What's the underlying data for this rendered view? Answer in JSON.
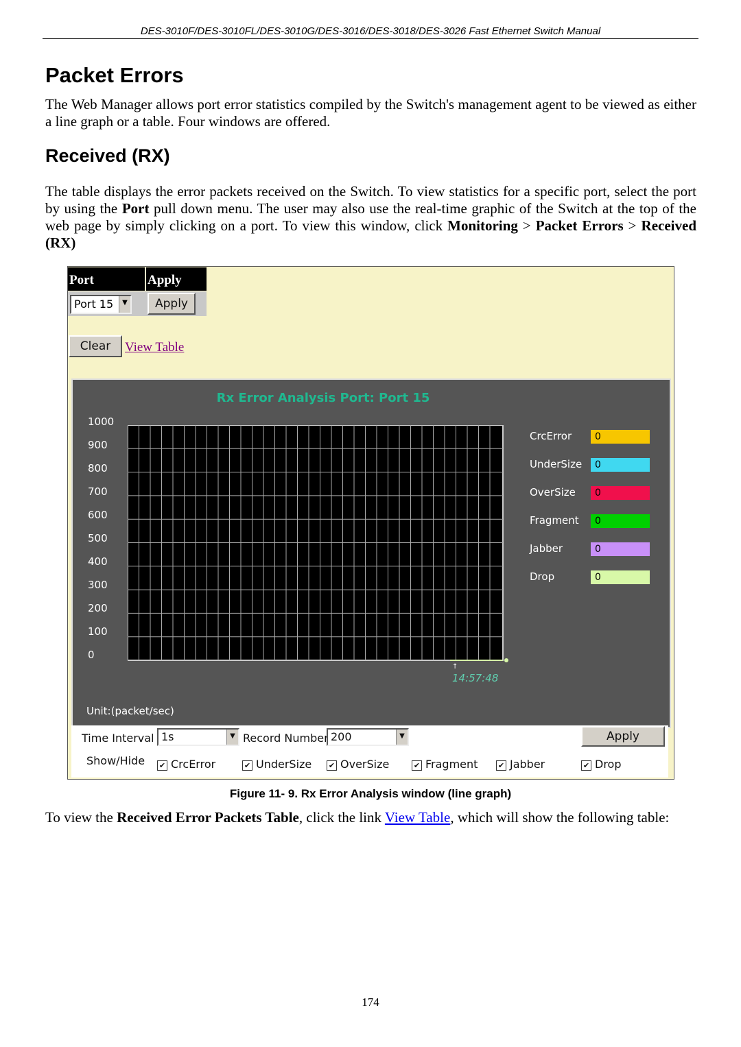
{
  "header": "DES-3010F/DES-3010FL/DES-3010G/DES-3016/DES-3018/DES-3026 Fast Ethernet Switch Manual",
  "title": "Packet Errors",
  "intro": "The Web Manager allows port error statistics compiled by the Switch's management agent to be viewed as either a line graph or a table. Four windows are offered.",
  "section": "Received (RX)",
  "body": {
    "t1": "The table displays the error packets received on the Switch. To view statistics for a specific port, select the port by using the ",
    "b1": "Port",
    "t2": " pull down menu. The user may also use the real-time graphic of the Switch at the top of the web page by simply clicking on a port. To view this window, click ",
    "b2": "Monitoring",
    "t3": " > ",
    "b3": "Packet Errors",
    "t4": " > ",
    "b4": "Received (RX)"
  },
  "screenshot": {
    "port_header": "Port",
    "apply_header": "Apply",
    "port_value": "Port 15",
    "apply": "Apply",
    "clear": "Clear",
    "view_table": "View Table",
    "chart_title": "Rx Error Analysis Port: Port 15",
    "unit": "Unit:(packet/sec)",
    "time_label": "14:57:48",
    "time_interval_label": "Time Interval",
    "time_interval": "1s",
    "record_number_label": "Record Number",
    "record_number": "200",
    "apply2": "Apply",
    "showhide": "Show/Hide"
  },
  "chart_data": {
    "type": "line",
    "ylim": [
      0,
      1000
    ],
    "yticks": [
      "1000",
      "900",
      "800",
      "700",
      "600",
      "500",
      "400",
      "300",
      "200",
      "100",
      "0"
    ],
    "grid": true,
    "series": [
      {
        "name": "CrcError",
        "value": "0",
        "color": "#f7c600"
      },
      {
        "name": "UnderSize",
        "value": "0",
        "color": "#40d8f0"
      },
      {
        "name": "OverSize",
        "value": "0",
        "color": "#f0104c"
      },
      {
        "name": "Fragment",
        "value": "0",
        "color": "#00d000"
      },
      {
        "name": "Jabber",
        "value": "0",
        "color": "#c890f8"
      },
      {
        "name": "Drop",
        "value": "0",
        "color": "#d8f8a8"
      }
    ]
  },
  "checkboxes": [
    {
      "label": "CrcError",
      "checked": true
    },
    {
      "label": "UnderSize",
      "checked": true
    },
    {
      "label": "OverSize",
      "checked": true
    },
    {
      "label": "Fragment",
      "checked": true
    },
    {
      "label": "Jabber",
      "checked": true
    },
    {
      "label": "Drop",
      "checked": true
    }
  ],
  "caption": "Figure 11- 9. Rx Error Analysis window (line graph)",
  "outro": {
    "t1": "To view the ",
    "b1": "Received Error Packets Table",
    "t2": ", click the link ",
    "link": "View Table",
    "t3": ", which will show the following table:"
  },
  "page_number": "174"
}
